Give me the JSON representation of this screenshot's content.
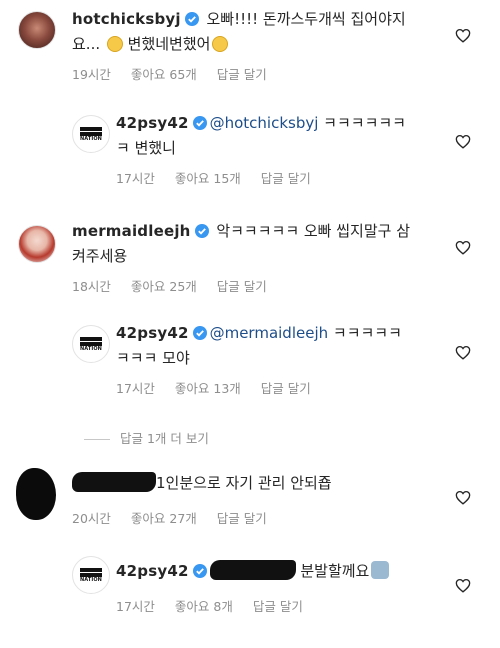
{
  "comments": [
    {
      "username": "hotchicksbyj",
      "text_line1": " 오빠!!!! 돈까스두개씩 집어야지",
      "text_line2": "요... ",
      "text_line2b": " 변했네변했어",
      "time": "19시간",
      "likes": "좋아요 65개",
      "reply": "답글 달기"
    },
    {
      "username": "42psy42",
      "mention": "@hotchicksbyj",
      "text_line1": " ㅋㅋㅋㅋㅋㅋ",
      "text_line2": "ㅋ 변했니",
      "time": "17시간",
      "likes": "좋아요 15개",
      "reply": "답글 달기"
    },
    {
      "username": "mermaidleejh",
      "text_line1": " 악ㅋㅋㅋㅋㅋ 오빠 씹지말구 삼",
      "text_line2": "켜주세용",
      "time": "18시간",
      "likes": "좋아요 25개",
      "reply": "답글 달기"
    },
    {
      "username": "42psy42",
      "mention": "@mermaidleejh",
      "text_line1": " ㅋㅋㅋㅋㅋ",
      "text_line2": "ㅋㅋㅋ 모야",
      "time": "17시간",
      "likes": "좋아요 13개",
      "reply": "답글 달기"
    },
    {
      "username": "",
      "text_line1": "1인분으로 자기 관리 안되죱",
      "time": "20시간",
      "likes": "좋아요 27개",
      "reply": "답글 달기"
    },
    {
      "username": "42psy42",
      "text_line1": " 분발할께요",
      "time": "17시간",
      "likes": "좋아요 8개",
      "reply": "답글 달기"
    }
  ],
  "more_replies": "답글 1개 더 보기",
  "logo_text": "NATION",
  "colors": {
    "verified": "#3897f0",
    "muted": "#8e8e8e",
    "mention": "#1d4e89"
  },
  "icons": {
    "verified": "verified-badge-icon",
    "heart": "heart-outline-icon"
  }
}
